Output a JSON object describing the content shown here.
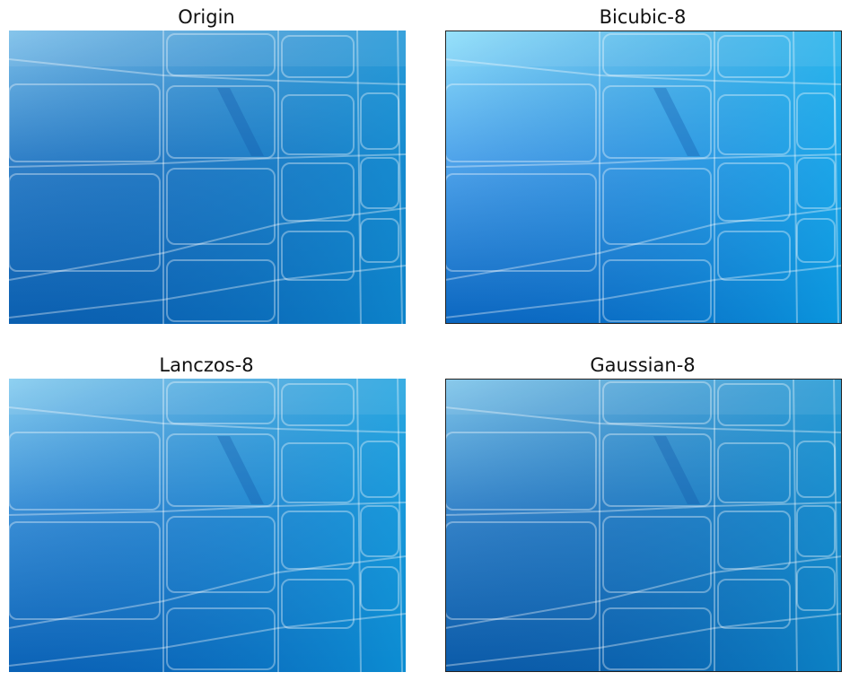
{
  "panels": [
    {
      "title": "Origin",
      "image": "blue-glass-tiles-wallpaper",
      "colors": {
        "top": "#7cc0ea",
        "mid": "#2f7fc7",
        "bottom": "#0a5fb0",
        "right": "#0d8fd3"
      }
    },
    {
      "title": "Bicubic-8",
      "image": "blue-glass-tiles-wallpaper",
      "colors": {
        "top": "#8fe0fb",
        "mid": "#4fa3ea",
        "bottom": "#0a66c0",
        "right": "#0aa7e8"
      }
    },
    {
      "title": "Lanczos-8",
      "image": "blue-glass-tiles-wallpaper",
      "colors": {
        "top": "#86cdf0",
        "mid": "#3b8fd6",
        "bottom": "#0a62b6",
        "right": "#0c9bdc"
      }
    },
    {
      "title": "Gaussian-8",
      "image": "blue-glass-tiles-wallpaper",
      "colors": {
        "top": "#80c6ea",
        "mid": "#3684c9",
        "bottom": "#0a5aa8",
        "right": "#0c8fcf"
      }
    }
  ]
}
